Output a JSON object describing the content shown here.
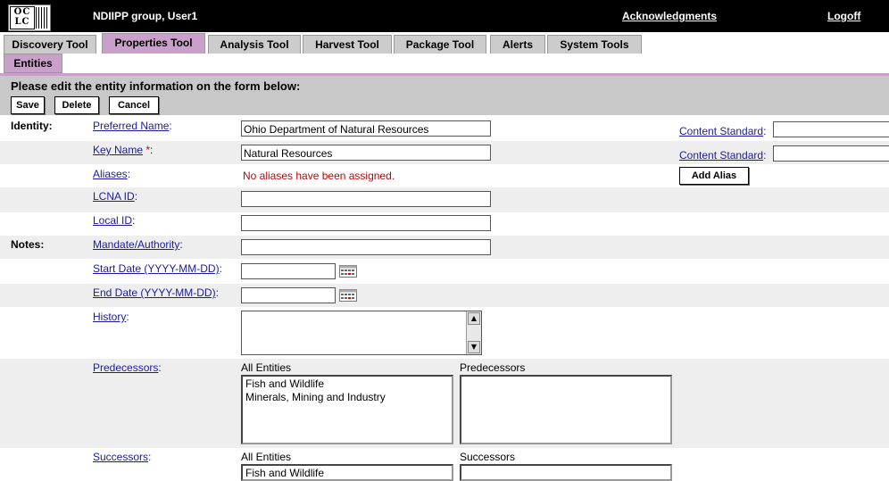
{
  "header": {
    "logo_text": "OC LC",
    "group_user": "NDIIPP group, User1",
    "acknowledgments": "Acknowledgments",
    "logoff": "Logoff"
  },
  "tabs": [
    {
      "label": "Discovery Tool"
    },
    {
      "label": "Properties Tool"
    },
    {
      "label": "Analysis Tool"
    },
    {
      "label": "Harvest Tool"
    },
    {
      "label": "Package Tool"
    },
    {
      "label": "Alerts"
    },
    {
      "label": "System Tools"
    }
  ],
  "subtab": {
    "label": "Entities"
  },
  "form": {
    "instruction": "Please edit the entity information on the form below:",
    "save": "Save",
    "delete": "Delete",
    "cancel": "Cancel",
    "identity": "Identity:",
    "notes": "Notes:",
    "preferred_name_label": "Preferred Name",
    "preferred_name_value": "Ohio Department of Natural Resources",
    "key_name_label": "Key Name",
    "key_name_req": "*",
    "key_name_value": "Natural Resources",
    "aliases_label": "Aliases",
    "no_aliases": "No aliases have been assigned.",
    "lcna_label": "LCNA ID",
    "local_label": "Local ID",
    "mandate_label": "Mandate/Authority",
    "start_label": "Start Date (YYYY-MM-DD)",
    "end_label": "End Date (YYYY-MM-DD)",
    "history_label": "History",
    "content_standard_1": "Content Standard",
    "content_standard_2": "Content Standard",
    "add_alias": "Add Alias",
    "predecessors_label": "Predecessors",
    "all_entities_1": "All Entities",
    "predecessors_list_label": "Predecessors",
    "all_entities_items": [
      "Fish and Wildlife",
      "Minerals, Mining and Industry"
    ],
    "successors_label": "Successors",
    "all_entities_2": "All Entities",
    "successors_list_label": "Successors",
    "successor_items": [
      "Fish and Wildlife"
    ]
  },
  "colors": {
    "topbar": "#000000",
    "active_tab": "#c9a0c9",
    "header_bg": "#c8c8c8",
    "link": "#1a1aa6"
  }
}
